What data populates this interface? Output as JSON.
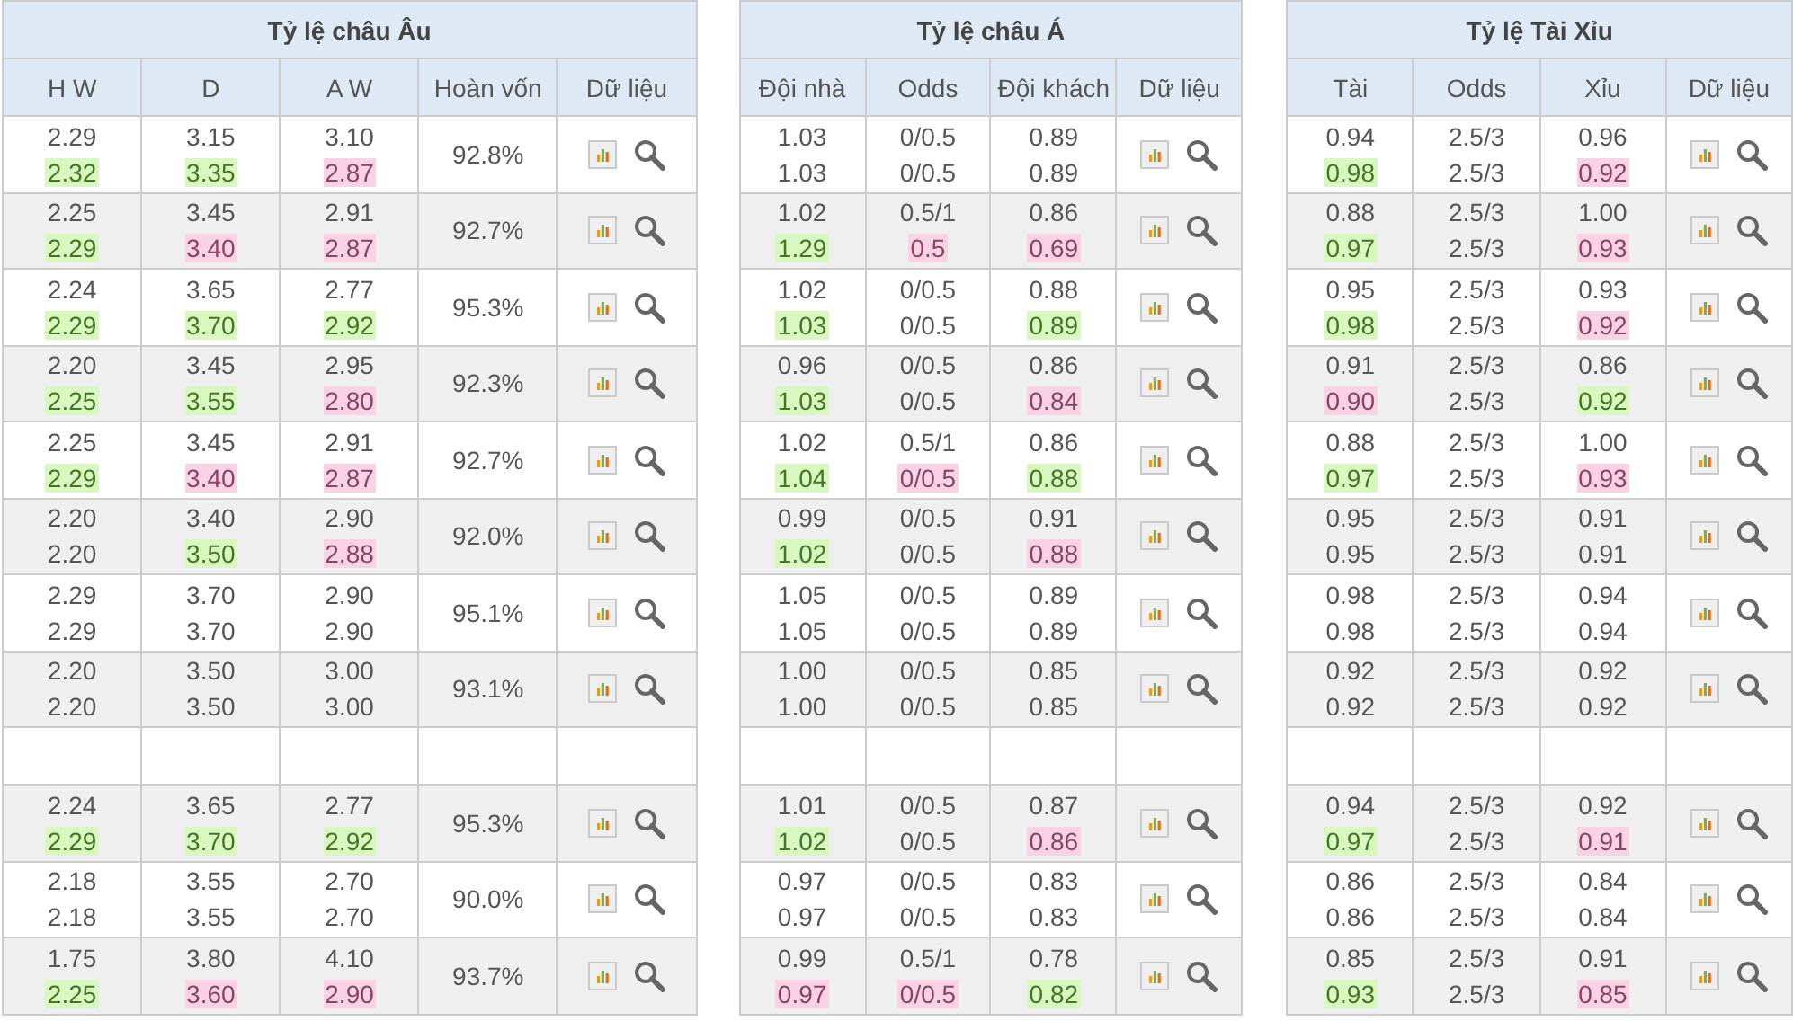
{
  "tables": [
    {
      "title": "Tỷ lệ châu Âu",
      "columns": [
        "H W",
        "D",
        "A W",
        "Hoàn vốn",
        "Dữ liệu"
      ],
      "rows": [
        {
          "kind": "odds",
          "cells": [
            {
              "open": "2.29",
              "live": "2.32",
              "up": true,
              "down": false
            },
            {
              "open": "3.15",
              "live": "3.35",
              "up": true,
              "down": false
            },
            {
              "open": "3.10",
              "live": "2.87",
              "up": false,
              "down": true
            }
          ],
          "payout": "92.8%"
        },
        {
          "kind": "odds",
          "cells": [
            {
              "open": "2.25",
              "live": "2.29",
              "up": true,
              "down": false
            },
            {
              "open": "3.45",
              "live": "3.40",
              "up": false,
              "down": true
            },
            {
              "open": "2.91",
              "live": "2.87",
              "up": false,
              "down": true
            }
          ],
          "payout": "92.7%"
        },
        {
          "kind": "odds",
          "cells": [
            {
              "open": "2.24",
              "live": "2.29",
              "up": true,
              "down": false
            },
            {
              "open": "3.65",
              "live": "3.70",
              "up": true,
              "down": false
            },
            {
              "open": "2.77",
              "live": "2.92",
              "up": true,
              "down": false
            }
          ],
          "payout": "95.3%"
        },
        {
          "kind": "odds",
          "cells": [
            {
              "open": "2.20",
              "live": "2.25",
              "up": true,
              "down": false
            },
            {
              "open": "3.45",
              "live": "3.55",
              "up": true,
              "down": false
            },
            {
              "open": "2.95",
              "live": "2.80",
              "up": false,
              "down": true
            }
          ],
          "payout": "92.3%"
        },
        {
          "kind": "odds",
          "cells": [
            {
              "open": "2.25",
              "live": "2.29",
              "up": true,
              "down": false
            },
            {
              "open": "3.45",
              "live": "3.40",
              "up": false,
              "down": true
            },
            {
              "open": "2.91",
              "live": "2.87",
              "up": false,
              "down": true
            }
          ],
          "payout": "92.7%"
        },
        {
          "kind": "odds",
          "cells": [
            {
              "open": "2.20",
              "live": "2.20",
              "up": false,
              "down": false
            },
            {
              "open": "3.40",
              "live": "3.50",
              "up": true,
              "down": false
            },
            {
              "open": "2.90",
              "live": "2.88",
              "up": false,
              "down": true
            }
          ],
          "payout": "92.0%"
        },
        {
          "kind": "odds",
          "cells": [
            {
              "open": "2.29",
              "live": "2.29",
              "up": false,
              "down": false
            },
            {
              "open": "3.70",
              "live": "3.70",
              "up": false,
              "down": false
            },
            {
              "open": "2.90",
              "live": "2.90",
              "up": false,
              "down": false
            }
          ],
          "payout": "95.1%"
        },
        {
          "kind": "odds",
          "cells": [
            {
              "open": "2.20",
              "live": "2.20",
              "up": false,
              "down": false
            },
            {
              "open": "3.50",
              "live": "3.50",
              "up": false,
              "down": false
            },
            {
              "open": "3.00",
              "live": "3.00",
              "up": false,
              "down": false
            }
          ],
          "payout": "93.1%"
        },
        {
          "kind": "blank"
        },
        {
          "kind": "odds",
          "cells": [
            {
              "open": "2.24",
              "live": "2.29",
              "up": true,
              "down": false
            },
            {
              "open": "3.65",
              "live": "3.70",
              "up": true,
              "down": false
            },
            {
              "open": "2.77",
              "live": "2.92",
              "up": true,
              "down": false
            }
          ],
          "payout": "95.3%"
        },
        {
          "kind": "odds",
          "cells": [
            {
              "open": "2.18",
              "live": "2.18",
              "up": false,
              "down": false
            },
            {
              "open": "3.55",
              "live": "3.55",
              "up": false,
              "down": false
            },
            {
              "open": "2.70",
              "live": "2.70",
              "up": false,
              "down": false
            }
          ],
          "payout": "90.0%"
        },
        {
          "kind": "odds",
          "cells": [
            {
              "open": "1.75",
              "live": "2.25",
              "up": true,
              "down": false
            },
            {
              "open": "3.80",
              "live": "3.60",
              "up": false,
              "down": true
            },
            {
              "open": "4.10",
              "live": "2.90",
              "up": false,
              "down": true
            }
          ],
          "payout": "93.7%"
        }
      ]
    },
    {
      "title": "Tỷ lệ châu Á",
      "columns": [
        "Đội nhà",
        "Odds",
        "Đội khách",
        "Dữ liệu"
      ],
      "rows": [
        {
          "kind": "odds",
          "cells": [
            {
              "open": "1.03",
              "live": "1.03",
              "up": false,
              "down": false
            },
            {
              "open": "0/0.5",
              "live": "0/0.5",
              "up": false,
              "down": false
            },
            {
              "open": "0.89",
              "live": "0.89",
              "up": false,
              "down": false
            }
          ]
        },
        {
          "kind": "odds",
          "cells": [
            {
              "open": "1.02",
              "live": "1.29",
              "up": true,
              "down": false
            },
            {
              "open": "0.5/1",
              "live": "0.5",
              "up": false,
              "down": true
            },
            {
              "open": "0.86",
              "live": "0.69",
              "up": false,
              "down": true
            }
          ]
        },
        {
          "kind": "odds",
          "cells": [
            {
              "open": "1.02",
              "live": "1.03",
              "up": true,
              "down": false
            },
            {
              "open": "0/0.5",
              "live": "0/0.5",
              "up": false,
              "down": false
            },
            {
              "open": "0.88",
              "live": "0.89",
              "up": true,
              "down": false
            }
          ]
        },
        {
          "kind": "odds",
          "cells": [
            {
              "open": "0.96",
              "live": "1.03",
              "up": true,
              "down": false
            },
            {
              "open": "0/0.5",
              "live": "0/0.5",
              "up": false,
              "down": false
            },
            {
              "open": "0.86",
              "live": "0.84",
              "up": false,
              "down": true
            }
          ]
        },
        {
          "kind": "odds",
          "cells": [
            {
              "open": "1.02",
              "live": "1.04",
              "up": true,
              "down": false
            },
            {
              "open": "0.5/1",
              "live": "0/0.5",
              "up": false,
              "down": true
            },
            {
              "open": "0.86",
              "live": "0.88",
              "up": true,
              "down": false
            }
          ]
        },
        {
          "kind": "odds",
          "cells": [
            {
              "open": "0.99",
              "live": "1.02",
              "up": true,
              "down": false
            },
            {
              "open": "0/0.5",
              "live": "0/0.5",
              "up": false,
              "down": false
            },
            {
              "open": "0.91",
              "live": "0.88",
              "up": false,
              "down": true
            }
          ]
        },
        {
          "kind": "odds",
          "cells": [
            {
              "open": "1.05",
              "live": "1.05",
              "up": false,
              "down": false
            },
            {
              "open": "0/0.5",
              "live": "0/0.5",
              "up": false,
              "down": false
            },
            {
              "open": "0.89",
              "live": "0.89",
              "up": false,
              "down": false
            }
          ]
        },
        {
          "kind": "odds",
          "cells": [
            {
              "open": "1.00",
              "live": "1.00",
              "up": false,
              "down": false
            },
            {
              "open": "0/0.5",
              "live": "0/0.5",
              "up": false,
              "down": false
            },
            {
              "open": "0.85",
              "live": "0.85",
              "up": false,
              "down": false
            }
          ]
        },
        {
          "kind": "blank"
        },
        {
          "kind": "odds",
          "cells": [
            {
              "open": "1.01",
              "live": "1.02",
              "up": true,
              "down": false
            },
            {
              "open": "0/0.5",
              "live": "0/0.5",
              "up": false,
              "down": false
            },
            {
              "open": "0.87",
              "live": "0.86",
              "up": false,
              "down": true
            }
          ]
        },
        {
          "kind": "odds",
          "cells": [
            {
              "open": "0.97",
              "live": "0.97",
              "up": false,
              "down": false
            },
            {
              "open": "0/0.5",
              "live": "0/0.5",
              "up": false,
              "down": false
            },
            {
              "open": "0.83",
              "live": "0.83",
              "up": false,
              "down": false
            }
          ]
        },
        {
          "kind": "odds",
          "cells": [
            {
              "open": "0.99",
              "live": "0.97",
              "up": false,
              "down": true
            },
            {
              "open": "0.5/1",
              "live": "0/0.5",
              "up": false,
              "down": true
            },
            {
              "open": "0.78",
              "live": "0.82",
              "up": true,
              "down": false
            }
          ]
        }
      ]
    },
    {
      "title": "Tỷ lệ Tài Xỉu",
      "columns": [
        "Tài",
        "Odds",
        "Xỉu",
        "Dữ liệu"
      ],
      "rows": [
        {
          "kind": "odds",
          "cells": [
            {
              "open": "0.94",
              "live": "0.98",
              "up": true,
              "down": false
            },
            {
              "open": "2.5/3",
              "live": "2.5/3",
              "up": false,
              "down": false
            },
            {
              "open": "0.96",
              "live": "0.92",
              "up": false,
              "down": true
            }
          ]
        },
        {
          "kind": "odds",
          "cells": [
            {
              "open": "0.88",
              "live": "0.97",
              "up": true,
              "down": false
            },
            {
              "open": "2.5/3",
              "live": "2.5/3",
              "up": false,
              "down": false
            },
            {
              "open": "1.00",
              "live": "0.93",
              "up": false,
              "down": true
            }
          ]
        },
        {
          "kind": "odds",
          "cells": [
            {
              "open": "0.95",
              "live": "0.98",
              "up": true,
              "down": false
            },
            {
              "open": "2.5/3",
              "live": "2.5/3",
              "up": false,
              "down": false
            },
            {
              "open": "0.93",
              "live": "0.92",
              "up": false,
              "down": true
            }
          ]
        },
        {
          "kind": "odds",
          "cells": [
            {
              "open": "0.91",
              "live": "0.90",
              "up": false,
              "down": true
            },
            {
              "open": "2.5/3",
              "live": "2.5/3",
              "up": false,
              "down": false
            },
            {
              "open": "0.86",
              "live": "0.92",
              "up": true,
              "down": false
            }
          ]
        },
        {
          "kind": "odds",
          "cells": [
            {
              "open": "0.88",
              "live": "0.97",
              "up": true,
              "down": false
            },
            {
              "open": "2.5/3",
              "live": "2.5/3",
              "up": false,
              "down": false
            },
            {
              "open": "1.00",
              "live": "0.93",
              "up": false,
              "down": true
            }
          ]
        },
        {
          "kind": "odds",
          "cells": [
            {
              "open": "0.95",
              "live": "0.95",
              "up": false,
              "down": false
            },
            {
              "open": "2.5/3",
              "live": "2.5/3",
              "up": false,
              "down": false
            },
            {
              "open": "0.91",
              "live": "0.91",
              "up": false,
              "down": false
            }
          ]
        },
        {
          "kind": "odds",
          "cells": [
            {
              "open": "0.98",
              "live": "0.98",
              "up": false,
              "down": false
            },
            {
              "open": "2.5/3",
              "live": "2.5/3",
              "up": false,
              "down": false
            },
            {
              "open": "0.94",
              "live": "0.94",
              "up": false,
              "down": false
            }
          ]
        },
        {
          "kind": "odds",
          "cells": [
            {
              "open": "0.92",
              "live": "0.92",
              "up": false,
              "down": false
            },
            {
              "open": "2.5/3",
              "live": "2.5/3",
              "up": false,
              "down": false
            },
            {
              "open": "0.92",
              "live": "0.92",
              "up": false,
              "down": false
            }
          ]
        },
        {
          "kind": "blank"
        },
        {
          "kind": "odds",
          "cells": [
            {
              "open": "0.94",
              "live": "0.97",
              "up": true,
              "down": false
            },
            {
              "open": "2.5/3",
              "live": "2.5/3",
              "up": false,
              "down": false
            },
            {
              "open": "0.92",
              "live": "0.91",
              "up": false,
              "down": true
            }
          ]
        },
        {
          "kind": "odds",
          "cells": [
            {
              "open": "0.86",
              "live": "0.86",
              "up": false,
              "down": false
            },
            {
              "open": "2.5/3",
              "live": "2.5/3",
              "up": false,
              "down": false
            },
            {
              "open": "0.84",
              "live": "0.84",
              "up": false,
              "down": false
            }
          ]
        },
        {
          "kind": "odds",
          "cells": [
            {
              "open": "0.85",
              "live": "0.93",
              "up": true,
              "down": false
            },
            {
              "open": "2.5/3",
              "live": "2.5/3",
              "up": false,
              "down": false
            },
            {
              "open": "0.91",
              "live": "0.85",
              "up": false,
              "down": true
            }
          ]
        }
      ]
    }
  ]
}
